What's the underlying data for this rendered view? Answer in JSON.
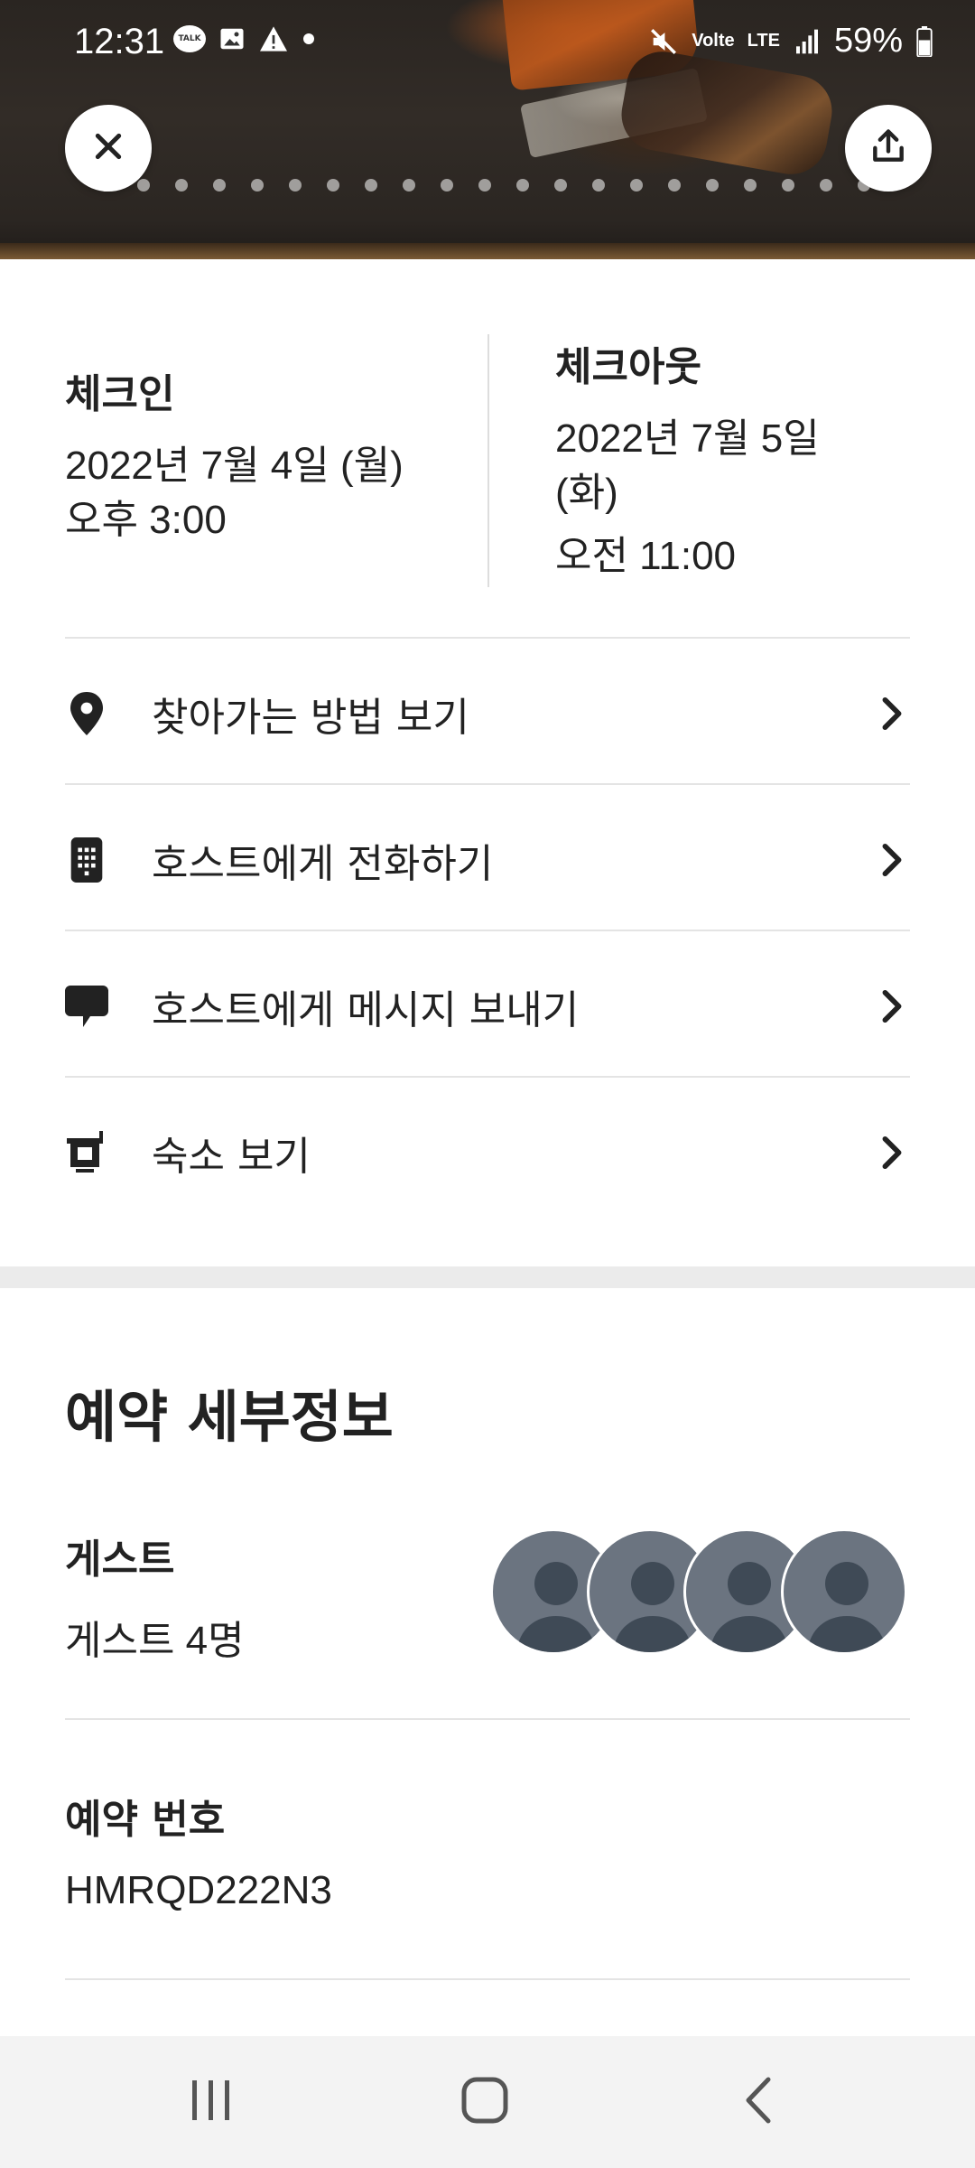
{
  "status_bar": {
    "time": "12:31",
    "battery": "59%",
    "network": "LTE",
    "volte": "Volte",
    "talk_badge": "TALK"
  },
  "hero": {
    "dots_count": 21,
    "active_dot": 0
  },
  "check_in": {
    "title": "체크인",
    "date": "2022년 7월 4일 (월)",
    "time": "오후 3:00"
  },
  "check_out": {
    "title": "체크아웃",
    "date_line1": "2022년 7월 5일",
    "date_line2": "(화)",
    "time": "오전 11:00"
  },
  "actions": [
    {
      "label": "찾아가는 방법 보기",
      "icon": "location-pin-icon"
    },
    {
      "label": "호스트에게 전화하기",
      "icon": "phone-keypad-icon"
    },
    {
      "label": "호스트에게 메시지 보내기",
      "icon": "message-bubble-icon"
    },
    {
      "label": "숙소 보기",
      "icon": "listing-icon"
    }
  ],
  "details": {
    "title": "예약 세부정보",
    "guests_label": "게스트",
    "guests_value": "게스트 4명",
    "reservation_label": "예약 번호",
    "reservation_value": "HMRQD222N3"
  },
  "colors": {
    "text": "#222222",
    "divider": "#e4e4e4",
    "avatar": "#6b7480"
  }
}
